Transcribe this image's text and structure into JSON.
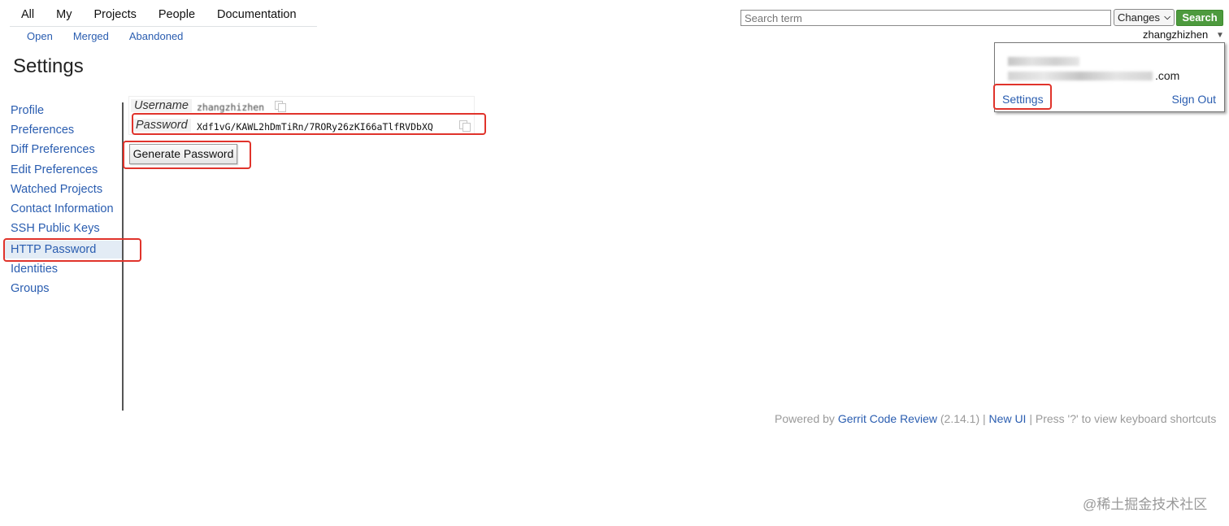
{
  "topnav": {
    "items": [
      "All",
      "My",
      "Projects",
      "People",
      "Documentation"
    ],
    "subitems": [
      "Open",
      "Merged",
      "Abandoned"
    ]
  },
  "search": {
    "placeholder": "Search term",
    "scope": "Changes",
    "button": "Search"
  },
  "user": {
    "name": "zhangzhizhen",
    "email_suffix": ".com",
    "settings_link": "Settings",
    "signout_link": "Sign Out"
  },
  "page": {
    "title": "Settings"
  },
  "sidebar": {
    "items": [
      {
        "label": "Profile"
      },
      {
        "label": "Preferences"
      },
      {
        "label": "Diff Preferences"
      },
      {
        "label": "Edit Preferences"
      },
      {
        "label": "Watched Projects"
      },
      {
        "label": "Contact Information"
      },
      {
        "label": "SSH Public Keys"
      },
      {
        "label": "HTTP Password",
        "active": true
      },
      {
        "label": "Identities"
      },
      {
        "label": "Groups"
      }
    ]
  },
  "http_password": {
    "username_label": "Username",
    "username_value": "zhangzhizhen",
    "password_label": "Password",
    "password_value": "Xdf1vG/KAWL2hDmTiRn/7RORy26zKI66aTlfRVDbXQ",
    "generate_button": "Generate Password"
  },
  "footer": {
    "powered_by": "Powered by",
    "product": "Gerrit Code Review",
    "version": "(2.14.1)",
    "sep": "|",
    "new_ui": "New UI",
    "shortcut_hint": "Press '?' to view keyboard shortcuts"
  },
  "watermark": "@稀土掘金技术社区",
  "colors": {
    "link": "#2a5db0",
    "search_button": "#4d9a3e",
    "highlight": "#e0332b"
  }
}
